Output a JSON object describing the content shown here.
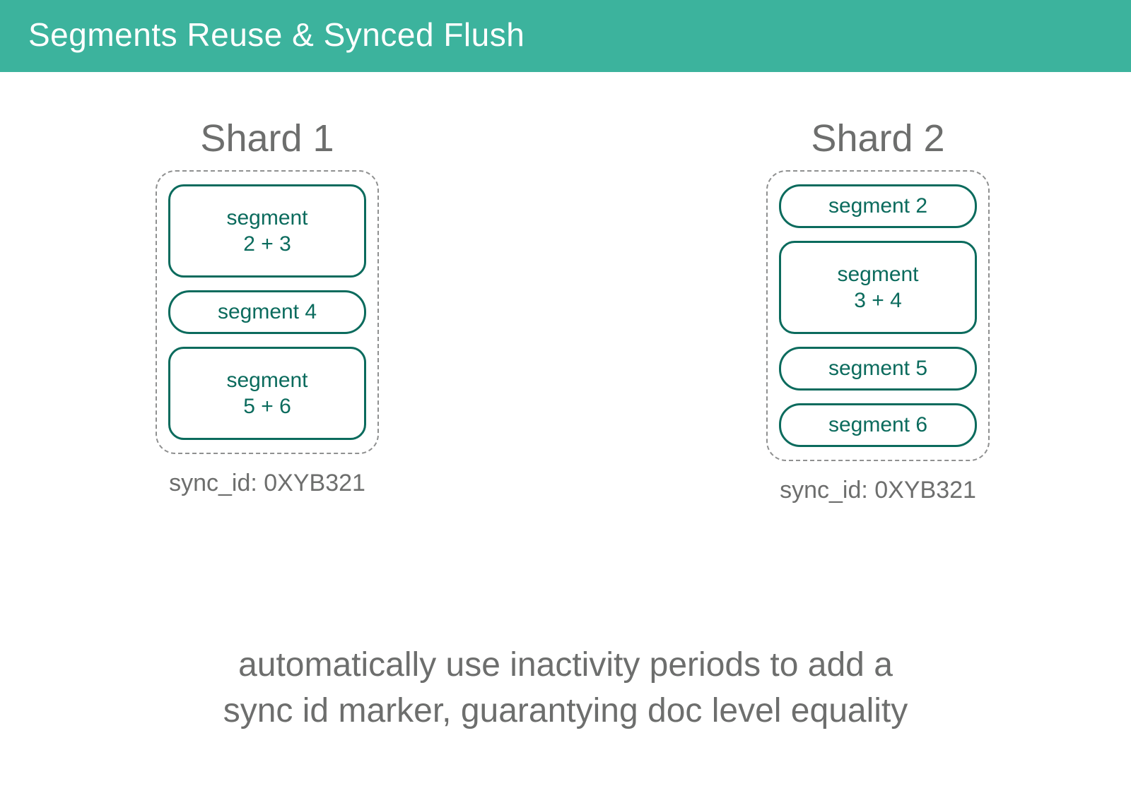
{
  "title": "Segments Reuse & Synced Flush",
  "shards": [
    {
      "name": "Shard 1",
      "segments": [
        {
          "lines": [
            "segment",
            "2 + 3"
          ],
          "size": "big"
        },
        {
          "lines": [
            "segment 4"
          ],
          "size": "small"
        },
        {
          "lines": [
            "segment",
            "5 + 6"
          ],
          "size": "big"
        }
      ],
      "sync_id": "sync_id: 0XYB321"
    },
    {
      "name": "Shard 2",
      "segments": [
        {
          "lines": [
            "segment 2"
          ],
          "size": "small"
        },
        {
          "lines": [
            "segment",
            "3 + 4"
          ],
          "size": "big"
        },
        {
          "lines": [
            "segment 5"
          ],
          "size": "small"
        },
        {
          "lines": [
            "segment 6"
          ],
          "size": "small"
        }
      ],
      "sync_id": "sync_id: 0XYB321"
    }
  ],
  "caption_line1": "automatically use inactivity periods to add a",
  "caption_line2": "sync id marker, guarantying doc level equality",
  "colors": {
    "accent": "#3cb39d",
    "segment_border": "#0b6b5d"
  }
}
